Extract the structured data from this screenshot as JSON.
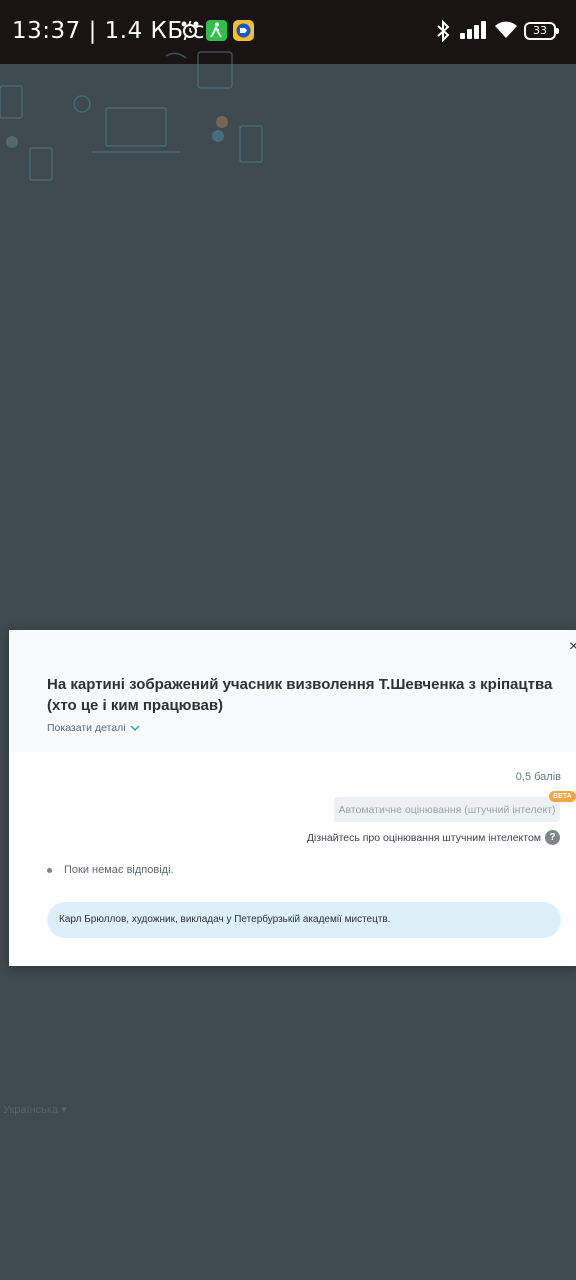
{
  "status_bar": {
    "time": "13:37",
    "net_speed": "1.4 КБ/с",
    "battery": "33",
    "icons": [
      "alarm-icon",
      "walk-icon",
      "screencast-icon",
      "bluetooth-icon",
      "signal-icon",
      "wifi-icon",
      "battery-icon"
    ]
  },
  "modal": {
    "close_label": "×",
    "question_title": "На картині зображений учасник визволення Т.Шевченка з кріпацтва (хто це і ким працював)",
    "show_details": "Показати деталі",
    "score": "0,5 балів",
    "ai_grading_button": "Автоматичне оцінювання (штучний інтелект)",
    "beta_badge": "BETA",
    "ai_learn_more": "Дізнайтесь про оцінювання штучним інтелектом",
    "help_label": "?",
    "no_answer": "Поки немає відповіді.",
    "feedback_text": "Карл Брюллов, художник, викладач у Петербурзькій академії мистецтв."
  },
  "footer": {
    "language": "Українська"
  },
  "colors": {
    "overlay": "#3e4a4f",
    "status_bar": "#1a1313",
    "feedback_bg": "#ddf0fa",
    "beta_bg": "#f5a546"
  }
}
